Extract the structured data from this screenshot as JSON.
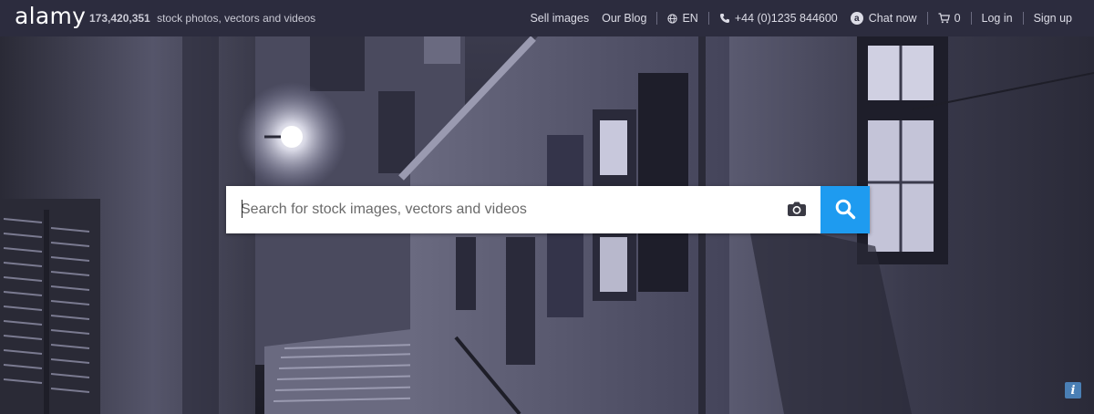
{
  "header": {
    "logo": "alamy",
    "image_count": "173,420,351",
    "tagline": "stock photos, vectors and videos",
    "nav": {
      "sell_images": "Sell images",
      "our_blog": "Our Blog",
      "language": "EN",
      "phone": "+44 (0)1235 844600",
      "chat": "Chat now",
      "chat_icon_letter": "a",
      "cart_count": "0",
      "login": "Log in",
      "signup": "Sign up"
    }
  },
  "search": {
    "placeholder": "Search for stock images, vectors and videos",
    "value": ""
  },
  "icons": {
    "globe": "globe-icon",
    "phone": "phone-icon",
    "chat": "chat-icon",
    "cart": "cart-icon",
    "camera": "camera-icon",
    "search": "search-icon",
    "info": "info-icon"
  },
  "colors": {
    "topbar_bg": "#2c2c3e",
    "search_button": "#1e9bf0",
    "info_badge": "#4a7fb5"
  },
  "info_label": "i"
}
